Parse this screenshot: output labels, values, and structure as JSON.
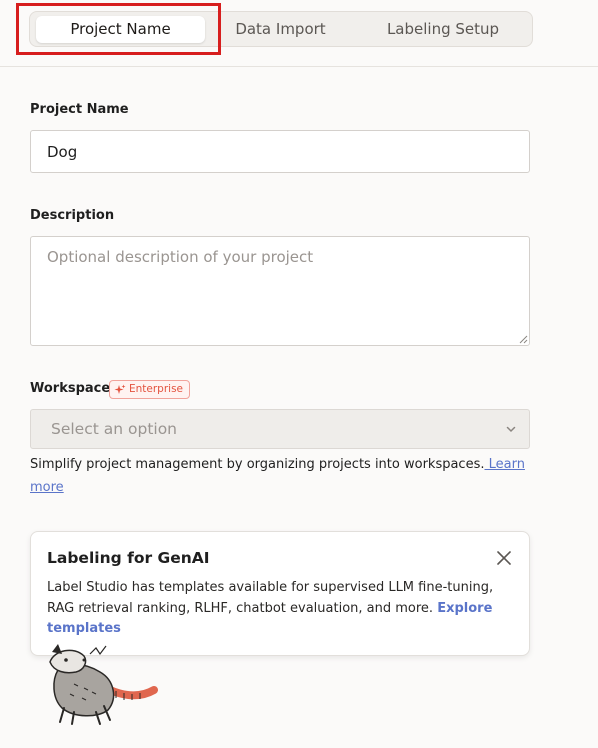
{
  "tabs": [
    {
      "label": "Project Name",
      "active": true
    },
    {
      "label": "Data Import",
      "active": false
    },
    {
      "label": "Labeling Setup",
      "active": false
    }
  ],
  "project_name": {
    "label": "Project Name",
    "value": "Dog"
  },
  "description": {
    "label": "Description",
    "placeholder": "Optional description of your project"
  },
  "workspace": {
    "label": "Workspace",
    "badge": "Enterprise",
    "select_placeholder": "Select an option",
    "help_text": "Simplify project management by organizing projects into workspaces.",
    "help_link": " Learn more"
  },
  "genai_card": {
    "title": "Labeling for GenAI",
    "body": "Label Studio has templates available for supervised LLM fine-tuning, RAG retrieval ranking, RLHF, chatbot evaluation, and more.",
    "link": "Explore templates"
  },
  "colors": {
    "highlight": "#d71e1e",
    "link": "#5a74c9",
    "badge": "#e3533f"
  }
}
